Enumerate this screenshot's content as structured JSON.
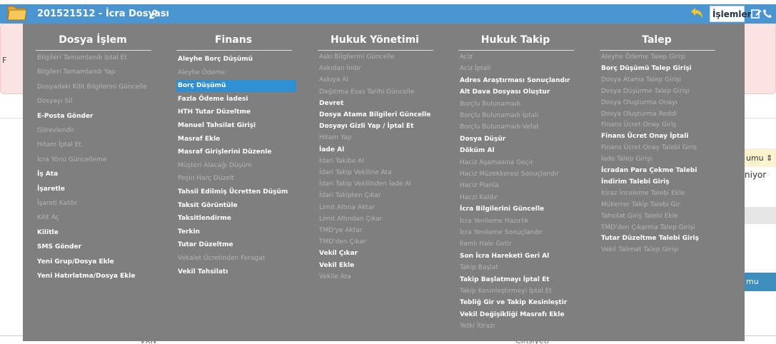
{
  "header": {
    "title": "201521512 - İcra Dosyası",
    "islemler_label": "İşlemler",
    "bg_color": "#4a94d0"
  },
  "background": {
    "alert_prefix": "F",
    "sort_header": "umu ⇕",
    "cell_text": "niyor",
    "blue_label": "mu",
    "footer_left": "VKN",
    "footer_right": "Cinsiyeti"
  },
  "menu": {
    "bg_color": "#7f7f7f",
    "selected_color": "#2e8fd1",
    "columns": [
      {
        "title": "Dosya İşlem",
        "items": [
          {
            "label": "Bilgileri Tamamlandı İptal Et",
            "enabled": false
          },
          {
            "label": "Bilgileri Tamamlandı Yap",
            "enabled": false
          },
          {
            "label": "Dosyadaki Kilit Bilgilerini Güncelle",
            "enabled": false
          },
          {
            "label": "Dosyayı Sil",
            "enabled": false
          },
          {
            "label": "E-Posta Gönder",
            "enabled": true
          },
          {
            "label": "Görevlendir",
            "enabled": false
          },
          {
            "label": "Hitam İptal Et",
            "enabled": false
          },
          {
            "label": "İcra Yönü Güncelleme",
            "enabled": false
          },
          {
            "label": "İş Ata",
            "enabled": true
          },
          {
            "label": "İşaretle",
            "enabled": true
          },
          {
            "label": "İşareti Kaldır",
            "enabled": false
          },
          {
            "label": "Kilit Aç",
            "enabled": false
          },
          {
            "label": "Kilitle",
            "enabled": true
          },
          {
            "label": "SMS Gönder",
            "enabled": true
          },
          {
            "label": "Yeni Grup/Dosya Ekle",
            "enabled": true
          },
          {
            "label": "Yeni Hatırlatma/Dosya Ekle",
            "enabled": true
          }
        ]
      },
      {
        "title": "Finans",
        "items": [
          {
            "label": "Aleyhe Borç Düşümü",
            "enabled": true
          },
          {
            "label": "Aleyhe Ödeme",
            "enabled": false
          },
          {
            "label": "Borç Düşümü",
            "enabled": true,
            "selected": true
          },
          {
            "label": "Fazla Ödeme İadesi",
            "enabled": true
          },
          {
            "label": "HTH Tutar Düzeltme",
            "enabled": true
          },
          {
            "label": "Manuel Tahsilat Girişi",
            "enabled": true
          },
          {
            "label": "Masraf Ekle",
            "enabled": true
          },
          {
            "label": "Masraf Girişlerini Düzenle",
            "enabled": true
          },
          {
            "label": "Müşteri Alacağı Düşüm",
            "enabled": false
          },
          {
            "label": "Peşin Harç Düzelt",
            "enabled": false
          },
          {
            "label": "Tahsil Edilmiş Ücretten Düşüm",
            "enabled": true
          },
          {
            "label": "Taksit Görüntüle",
            "enabled": true
          },
          {
            "label": "Taksitlendirme",
            "enabled": true
          },
          {
            "label": "Terkin",
            "enabled": true
          },
          {
            "label": "Tutar Düzeltme",
            "enabled": true
          },
          {
            "label": "Vekalet Ücretinden Feragat",
            "enabled": false
          },
          {
            "label": "Vekil Tahsilatı",
            "enabled": true
          }
        ]
      },
      {
        "title": "Hukuk Yönetimi",
        "items": [
          {
            "label": "Askı Bilgilerini Güncelle",
            "enabled": false
          },
          {
            "label": "Askıdan İndir",
            "enabled": false
          },
          {
            "label": "Askıya Al",
            "enabled": false
          },
          {
            "label": "Dağıtıma Esas Tarihi Güncelle",
            "enabled": false
          },
          {
            "label": "Devret",
            "enabled": true
          },
          {
            "label": "Dosya Atama Bilgileri Güncelle",
            "enabled": true
          },
          {
            "label": "Dosyayı Gizli Yap / İptal Et",
            "enabled": true
          },
          {
            "label": "Hitam Yap",
            "enabled": false
          },
          {
            "label": "İade Al",
            "enabled": true
          },
          {
            "label": "İdari Takibe Al",
            "enabled": false
          },
          {
            "label": "İdari Takip Vekiline Ata",
            "enabled": false
          },
          {
            "label": "İdari Takip Vekilinden İade Al",
            "enabled": false
          },
          {
            "label": "İdari Takipten Çıkar",
            "enabled": false
          },
          {
            "label": "Limit Altına Aktar",
            "enabled": false
          },
          {
            "label": "Limit Altından Çıkar",
            "enabled": false
          },
          {
            "label": "TMD'ye Aktar",
            "enabled": false
          },
          {
            "label": "TMD'den Çıkar",
            "enabled": false
          },
          {
            "label": "Vekil Çıkar",
            "enabled": true
          },
          {
            "label": "Vekil Ekle",
            "enabled": true
          },
          {
            "label": "Vekile Ata",
            "enabled": false
          }
        ]
      },
      {
        "title": "Hukuk Takip",
        "items": [
          {
            "label": "Aciz",
            "enabled": false
          },
          {
            "label": "Aciz İptali",
            "enabled": false
          },
          {
            "label": "Adres Araştırması Sonuçlandır",
            "enabled": true
          },
          {
            "label": "Alt Dava Dosyası Oluştur",
            "enabled": true
          },
          {
            "label": "Borçlu Bulunamadı",
            "enabled": false
          },
          {
            "label": "Borçlu Bulunamadı İptali",
            "enabled": false
          },
          {
            "label": "Borçlu Bulunamadı-Vefat",
            "enabled": false
          },
          {
            "label": "Dosya Düşür",
            "enabled": true
          },
          {
            "label": "Döküm Al",
            "enabled": true
          },
          {
            "label": "Haciz Aşamasına Geçir",
            "enabled": false
          },
          {
            "label": "Haciz Müzekkeresi Sonuçlandır",
            "enabled": false
          },
          {
            "label": "Haciz Planla",
            "enabled": false
          },
          {
            "label": "Haczi Kaldır",
            "enabled": false
          },
          {
            "label": "İcra Bilgilerini Güncelle",
            "enabled": true
          },
          {
            "label": "İcra Yenileme Hazırlık",
            "enabled": false
          },
          {
            "label": "İcra Yenileme Sonuçlandır",
            "enabled": false
          },
          {
            "label": "İlamlı Hale Getir",
            "enabled": false
          },
          {
            "label": "Son İcra Hareketi Geri Al",
            "enabled": true
          },
          {
            "label": "Takip Başlat",
            "enabled": false
          },
          {
            "label": "Takip Başlatmayı İptal Et",
            "enabled": true
          },
          {
            "label": "Takip Kesinleştirmeyi İptal Et",
            "enabled": false
          },
          {
            "label": "Tebliğ Gir ve Takip Kesinleştir",
            "enabled": true
          },
          {
            "label": "Vekil Değişikliği Masrafı Ekle",
            "enabled": true
          },
          {
            "label": "Yetki İtirazı",
            "enabled": false
          }
        ]
      },
      {
        "title": "Talep",
        "items": [
          {
            "label": "Aleyhe Ödeme Talep Girişi",
            "enabled": false
          },
          {
            "label": "Borç Düşümü Talep Girişi",
            "enabled": true
          },
          {
            "label": "Dosya Atama Talep Girişi",
            "enabled": false
          },
          {
            "label": "Dosya Düşürme Talep Girişi",
            "enabled": false
          },
          {
            "label": "Dosya Oluşturma Onayı",
            "enabled": false
          },
          {
            "label": "Dosya Oluşturma Reddi",
            "enabled": false
          },
          {
            "label": "Finans Ücret Onay Giriş",
            "enabled": false
          },
          {
            "label": "Finans Ücret Onay İptali",
            "enabled": true
          },
          {
            "label": "Finans Ücret Onay Talebi Giriş",
            "enabled": false
          },
          {
            "label": "İade Talep Girişi",
            "enabled": false
          },
          {
            "label": "İcradan Para Çekme Talebi",
            "enabled": true
          },
          {
            "label": "İndirim Talebi Giriş",
            "enabled": true
          },
          {
            "label": "İtiraz İnceleme Talebi Ekle",
            "enabled": false
          },
          {
            "label": "Mükerrer Takip Talebi Gir",
            "enabled": false
          },
          {
            "label": "Tahsilat Giriş Talebi Ekle",
            "enabled": false
          },
          {
            "label": "TMD'den Çıkarma Talep Girişi",
            "enabled": false
          },
          {
            "label": "Tutar Düzeltme Talebi Giriş",
            "enabled": true
          },
          {
            "label": "Vekil Talimat Talep Girişi",
            "enabled": false
          }
        ]
      }
    ]
  }
}
